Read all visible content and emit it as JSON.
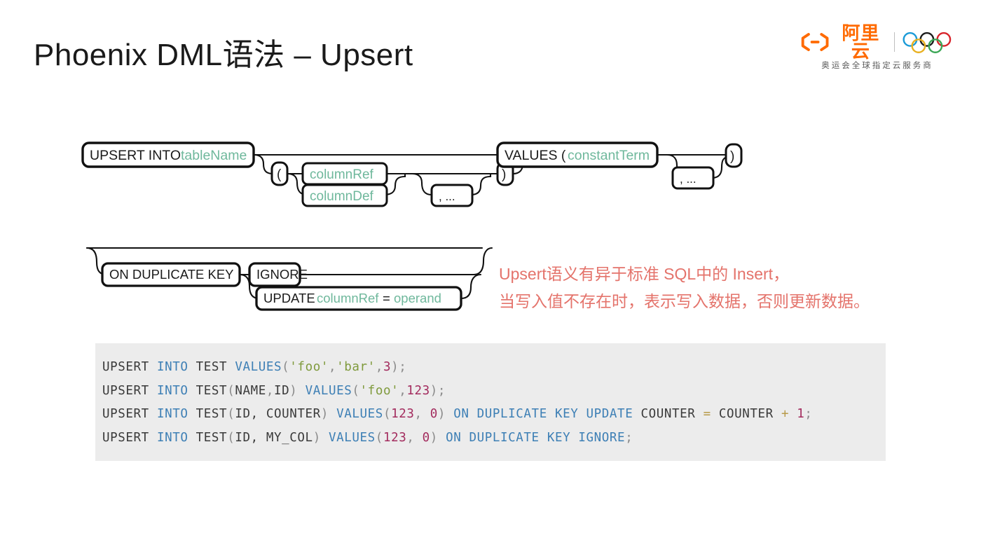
{
  "slide": {
    "title": "Phoenix DML语法 – Upsert"
  },
  "logo": {
    "brand_cn": "阿里云",
    "bracket_left": "(",
    "bracket_dash": "–",
    "bracket_right": ")",
    "tagline": "奥运会全球指定云服务商",
    "brand_color": "#ff6a00",
    "ring_colors": [
      "#1a9ad7",
      "#1a1a1a",
      "#d8232a",
      "#e8b020",
      "#3aa655"
    ]
  },
  "railroad_upsert": {
    "nodes": {
      "upsert_into": "UPSERT INTO",
      "table_name": "tableName",
      "paren_open": "(",
      "column_ref": "columnRef",
      "column_def": "columnDef",
      "comma_loop": ", ...",
      "paren_close": ")",
      "values_open": "VALUES (",
      "constant_term": "constantTerm",
      "values_comma_loop": ", ...",
      "values_close": ")"
    },
    "keyword_color": "#1a1a1a",
    "variable_color": "#6fb89c"
  },
  "railroad_onduplicate": {
    "nodes": {
      "on_duplicate_key": "ON DUPLICATE KEY",
      "ignore": "IGNORE",
      "update_kw": "UPDATE",
      "update_columnref": "columnRef",
      "update_eq": "=",
      "update_operand": "operand"
    },
    "keyword_color": "#1a1a1a",
    "variable_color": "#6fb89c"
  },
  "annotation": {
    "color": "#e4736b",
    "line1": "Upsert语义有异于标准 SQL中的 Insert，",
    "line2": "当写入值不存在时，表示写入数据，否则更新数据。"
  },
  "code_block": {
    "background": "#ececec",
    "language": "sql",
    "lines": [
      "UPSERT INTO TEST VALUES('foo','bar',3);",
      "UPSERT INTO TEST(NAME,ID) VALUES('foo',123);",
      "UPSERT INTO TEST(ID, COUNTER) VALUES(123, 0) ON DUPLICATE KEY UPDATE COUNTER = COUNTER + 1;",
      "UPSERT INTO TEST(ID, MY_COL) VALUES(123, 0) ON DUPLICATE KEY IGNORE;"
    ],
    "tokens": [
      [
        {
          "t": "UPSERT ",
          "c": "tok-id"
        },
        {
          "t": "INTO ",
          "c": "tok-kw"
        },
        {
          "t": "TEST ",
          "c": "tok-id"
        },
        {
          "t": "VALUES",
          "c": "tok-kw"
        },
        {
          "t": "(",
          "c": "tok-punc"
        },
        {
          "t": "'foo'",
          "c": "tok-str"
        },
        {
          "t": ",",
          "c": "tok-punc"
        },
        {
          "t": "'bar'",
          "c": "tok-str"
        },
        {
          "t": ",",
          "c": "tok-punc"
        },
        {
          "t": "3",
          "c": "tok-num"
        },
        {
          "t": ");",
          "c": "tok-punc"
        }
      ],
      [
        {
          "t": "UPSERT ",
          "c": "tok-id"
        },
        {
          "t": "INTO ",
          "c": "tok-kw"
        },
        {
          "t": "TEST",
          "c": "tok-id"
        },
        {
          "t": "(",
          "c": "tok-punc"
        },
        {
          "t": "NAME",
          "c": "tok-id"
        },
        {
          "t": ",",
          "c": "tok-punc"
        },
        {
          "t": "ID",
          "c": "tok-id"
        },
        {
          "t": ") ",
          "c": "tok-punc"
        },
        {
          "t": "VALUES",
          "c": "tok-kw"
        },
        {
          "t": "(",
          "c": "tok-punc"
        },
        {
          "t": "'foo'",
          "c": "tok-str"
        },
        {
          "t": ",",
          "c": "tok-punc"
        },
        {
          "t": "123",
          "c": "tok-num"
        },
        {
          "t": ");",
          "c": "tok-punc"
        }
      ],
      [
        {
          "t": "UPSERT ",
          "c": "tok-id"
        },
        {
          "t": "INTO ",
          "c": "tok-kw"
        },
        {
          "t": "TEST",
          "c": "tok-id"
        },
        {
          "t": "(",
          "c": "tok-punc"
        },
        {
          "t": "ID, COUNTER",
          "c": "tok-id"
        },
        {
          "t": ") ",
          "c": "tok-punc"
        },
        {
          "t": "VALUES",
          "c": "tok-kw"
        },
        {
          "t": "(",
          "c": "tok-punc"
        },
        {
          "t": "123",
          "c": "tok-num"
        },
        {
          "t": ", ",
          "c": "tok-punc"
        },
        {
          "t": "0",
          "c": "tok-num"
        },
        {
          "t": ") ",
          "c": "tok-punc"
        },
        {
          "t": "ON DUPLICATE KEY UPDATE ",
          "c": "tok-kw"
        },
        {
          "t": "COUNTER ",
          "c": "tok-id"
        },
        {
          "t": "= ",
          "c": "tok-op"
        },
        {
          "t": "COUNTER ",
          "c": "tok-id"
        },
        {
          "t": "+ ",
          "c": "tok-op"
        },
        {
          "t": "1",
          "c": "tok-num"
        },
        {
          "t": ";",
          "c": "tok-punc"
        }
      ],
      [
        {
          "t": "UPSERT ",
          "c": "tok-id"
        },
        {
          "t": "INTO ",
          "c": "tok-kw"
        },
        {
          "t": "TEST",
          "c": "tok-id"
        },
        {
          "t": "(",
          "c": "tok-punc"
        },
        {
          "t": "ID, MY_COL",
          "c": "tok-id"
        },
        {
          "t": ") ",
          "c": "tok-punc"
        },
        {
          "t": "VALUES",
          "c": "tok-kw"
        },
        {
          "t": "(",
          "c": "tok-punc"
        },
        {
          "t": "123",
          "c": "tok-num"
        },
        {
          "t": ", ",
          "c": "tok-punc"
        },
        {
          "t": "0",
          "c": "tok-num"
        },
        {
          "t": ") ",
          "c": "tok-punc"
        },
        {
          "t": "ON DUPLICATE KEY IGNORE",
          "c": "tok-kw"
        },
        {
          "t": ";",
          "c": "tok-punc"
        }
      ]
    ]
  }
}
